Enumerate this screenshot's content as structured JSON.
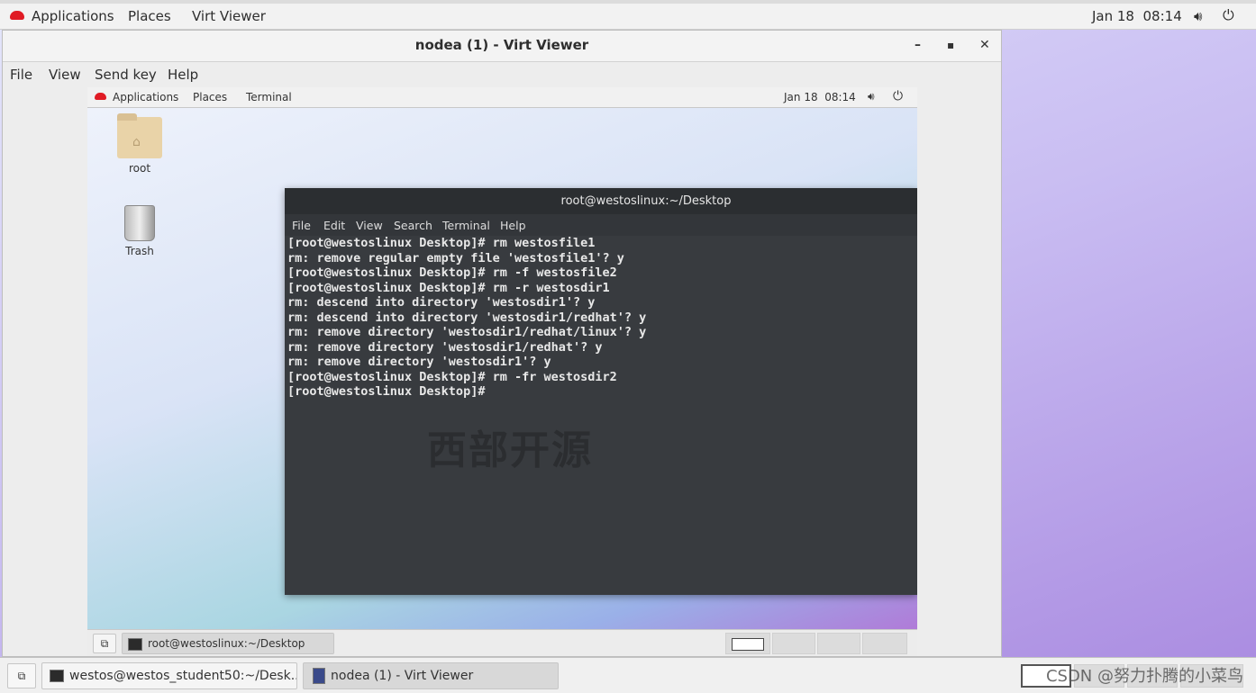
{
  "host_topbar": {
    "applications": "Applications",
    "places": "Places",
    "app": "Virt Viewer",
    "clock": "Jan 18  08:14"
  },
  "window": {
    "title": "nodea (1) - Virt Viewer",
    "menu": [
      "File",
      "View",
      "Send key",
      "Help"
    ],
    "minimize": "–",
    "maximize": "▪",
    "close": "✕"
  },
  "guest_topbar": {
    "applications": "Applications",
    "places": "Places",
    "app": "Terminal",
    "clock": "Jan 18  08:14"
  },
  "desktop_icons": [
    {
      "label": "root",
      "icon": "home-folder-icon"
    },
    {
      "label": "Trash",
      "icon": "trash-icon"
    }
  ],
  "terminal": {
    "title": "root@westoslinux:~/Desktop",
    "menu": [
      "File",
      "Edit",
      "View",
      "Search",
      "Terminal",
      "Help"
    ],
    "lines": [
      "[root@westoslinux Desktop]# rm westosfile1",
      "rm: remove regular empty file 'westosfile1'? y",
      "[root@westoslinux Desktop]# rm -f westosfile2",
      "[root@westoslinux Desktop]# rm -r westosdir1",
      "rm: descend into directory 'westosdir1'? y",
      "rm: descend into directory 'westosdir1/redhat'? y",
      "rm: remove directory 'westosdir1/redhat/linux'? y",
      "rm: remove directory 'westosdir1/redhat'? y",
      "rm: remove directory 'westosdir1'? y",
      "[root@westoslinux Desktop]# rm -fr westosdir2",
      "[root@westoslinux Desktop]#"
    ],
    "watermark": "西部开源"
  },
  "guest_taskbar": {
    "items": [
      "root@westoslinux:~/Desktop"
    ]
  },
  "host_taskbar": {
    "items": [
      "westos@westos_student50:~/Desk...",
      "nodea (1) - Virt Viewer"
    ]
  },
  "watermark": "CSDN @努力扑腾的小菜鸟"
}
